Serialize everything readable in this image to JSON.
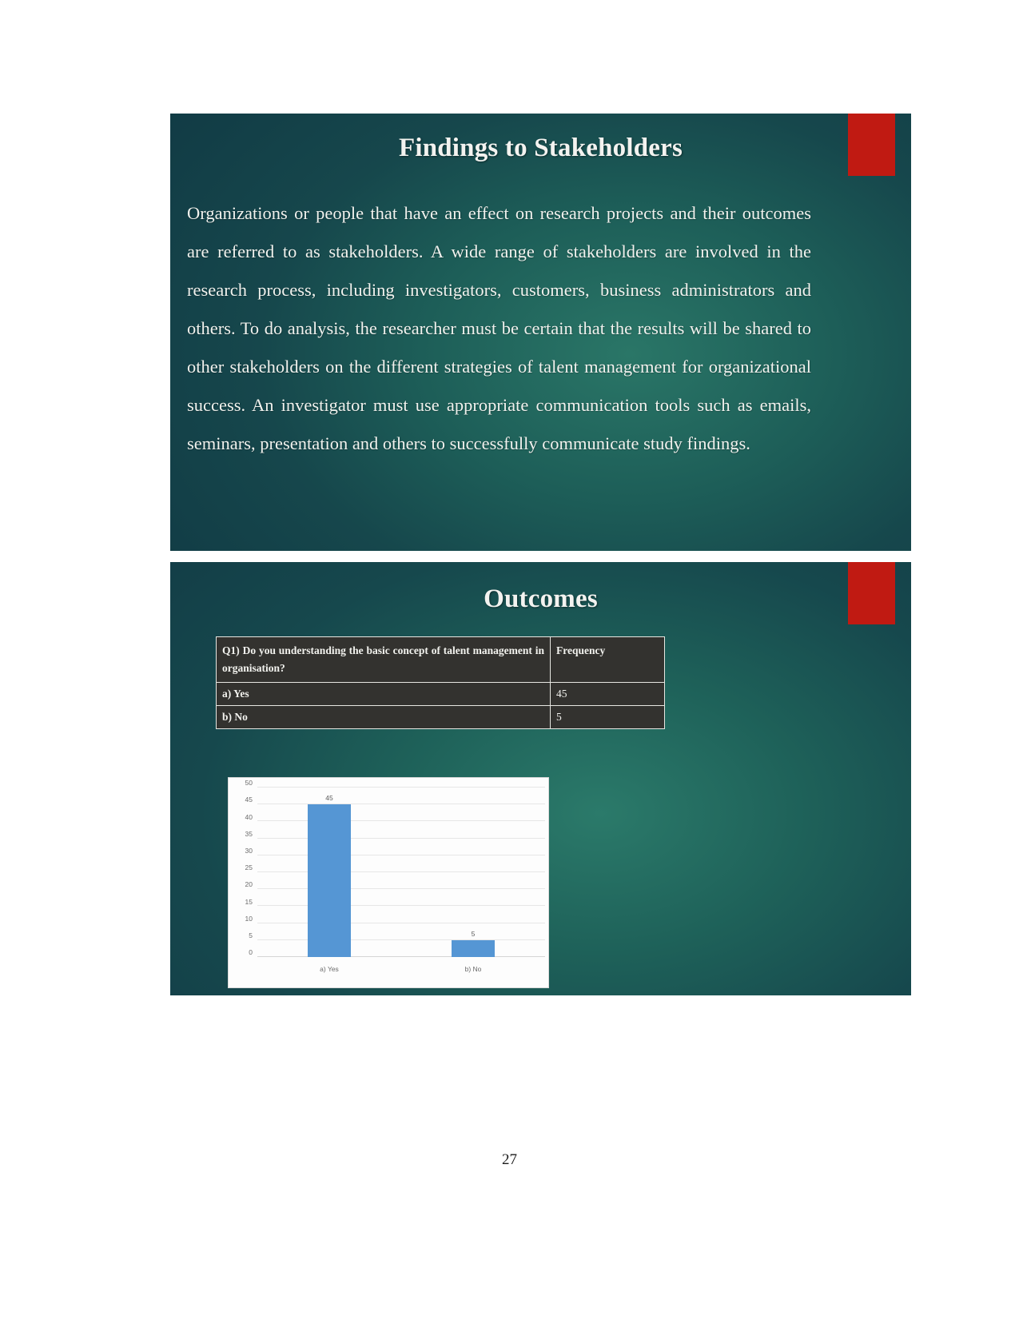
{
  "document": {
    "page_number": "27"
  },
  "slides": {
    "findings": {
      "title": "Findings to Stakeholders",
      "body": "Organizations or people that have an effect on research projects and their outcomes are referred to as stakeholders. A wide range of stakeholders are involved in the research process, including investigators, customers, business administrators and others. To do analysis, the researcher must be certain that the results will be shared to other stakeholders on the different strategies of talent management for organizational success. An investigator must use appropriate communication tools such as emails, seminars, presentation and others to successfully communicate study findings."
    },
    "outcomes": {
      "title": "Outcomes",
      "table": {
        "header": {
          "question": "Q1)  Do  you  understanding  the  basic  concept  of  talent management in organisation?",
          "frequency": "Frequency"
        },
        "rows": [
          {
            "option": "a) Yes",
            "frequency": "45"
          },
          {
            "option": "b) No",
            "frequency": "5"
          }
        ]
      }
    }
  },
  "chart_data": {
    "type": "bar",
    "title": "",
    "xlabel": "",
    "ylabel": "",
    "categories": [
      "a) Yes",
      "b) No"
    ],
    "values": [
      45,
      5
    ],
    "data_labels": [
      "45",
      "5"
    ],
    "ylim": [
      0,
      50
    ],
    "yticks": [
      "0",
      "5",
      "10",
      "15",
      "20",
      "25",
      "30",
      "35",
      "40",
      "45",
      "50"
    ],
    "grid": true,
    "legend": "none",
    "bar_color": "#5596d4"
  },
  "colors": {
    "accent_red": "#c01a12",
    "slide_teal_dark": "#123c46",
    "slide_teal_light": "#2b7a6a",
    "table_fill": "#33322f",
    "bar_blue": "#5596d4"
  }
}
